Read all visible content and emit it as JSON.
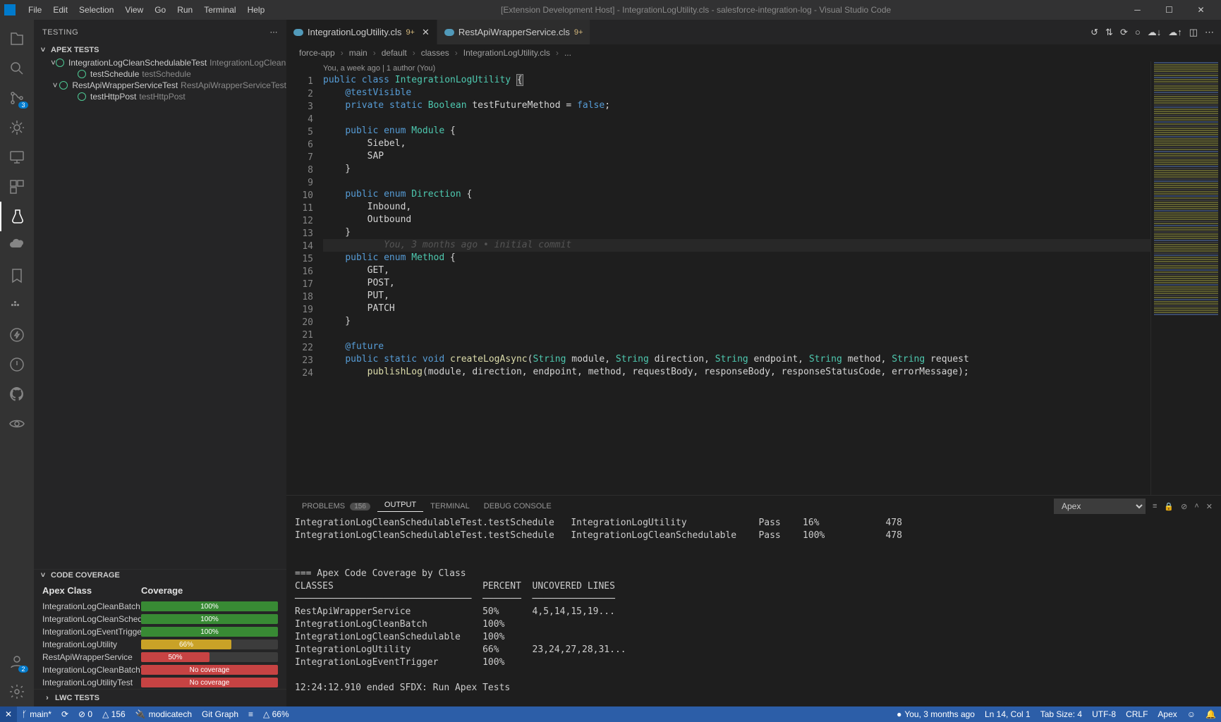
{
  "titlebar": {
    "title": "[Extension Development Host] - IntegrationLogUtility.cls - salesforce-integration-log - Visual Studio Code"
  },
  "menu": [
    "File",
    "Edit",
    "Selection",
    "View",
    "Go",
    "Run",
    "Terminal",
    "Help"
  ],
  "activity_badges": {
    "scm": "3",
    "accounts": "2"
  },
  "sidebar": {
    "title": "TESTING",
    "apex_tests_label": "APEX TESTS",
    "tests": [
      {
        "name": "IntegrationLogCleanSchedulableTest",
        "sub": "IntegrationLogCleanSchedula...",
        "indent": 24,
        "chev": "˅",
        "children": [
          {
            "name": "testSchedule",
            "sub": "testSchedule",
            "indent": 48
          }
        ]
      },
      {
        "name": "RestApiWrapperServiceTest",
        "sub": "RestApiWrapperServiceTest",
        "indent": 24,
        "chev": "˅",
        "children": [
          {
            "name": "testHttpPost",
            "sub": "testHttpPost",
            "indent": 48
          }
        ]
      }
    ],
    "coverage_label": "CODE COVERAGE",
    "coverage_col_class": "Apex Class",
    "coverage_col_cov": "Coverage",
    "coverage": [
      {
        "name": "IntegrationLogCleanBatch",
        "pct": 100,
        "label": "100%",
        "color": "#388a34"
      },
      {
        "name": "IntegrationLogCleanSchedulable",
        "pct": 100,
        "label": "100%",
        "color": "#388a34"
      },
      {
        "name": "IntegrationLogEventTrigger",
        "pct": 100,
        "label": "100%",
        "color": "#388a34"
      },
      {
        "name": "IntegrationLogUtility",
        "pct": 66,
        "label": "66%",
        "color": "#c9a227"
      },
      {
        "name": "RestApiWrapperService",
        "pct": 50,
        "label": "50%",
        "color": "#c74343"
      },
      {
        "name": "IntegrationLogCleanBatchTest",
        "pct": 100,
        "label": "No coverage",
        "color": "#c74343"
      },
      {
        "name": "IntegrationLogUtilityTest",
        "pct": 100,
        "label": "No coverage",
        "color": "#c74343"
      }
    ],
    "lwc_label": "LWC TESTS"
  },
  "tabs": [
    {
      "label": "IntegrationLogUtility.cls",
      "modified": "9+",
      "active": true,
      "closeable": true
    },
    {
      "label": "RestApiWrapperService.cls",
      "modified": "9+",
      "active": false,
      "closeable": false
    }
  ],
  "breadcrumbs": [
    "force-app",
    "main",
    "default",
    "classes",
    "IntegrationLogUtility.cls",
    "..."
  ],
  "codelens": "You, a week ago | 1 author (You)",
  "code": {
    "lines": [
      {
        "n": 1,
        "html": "<span class='kw'>public</span> <span class='kw'>class</span> <span class='type'>IntegrationLogUtility</span> <span class='bracket-match'>{</span>"
      },
      {
        "n": 2,
        "html": "    <span class='annotation'>@testVisible</span>"
      },
      {
        "n": 3,
        "html": "    <span class='kw'>private</span> <span class='kw'>static</span> <span class='type'>Boolean</span> testFutureMethod = <span class='bool'>false</span>;"
      },
      {
        "n": 4,
        "html": ""
      },
      {
        "n": 5,
        "html": "    <span class='kw'>public</span> <span class='kw'>enum</span> <span class='enumname'>Module</span> {"
      },
      {
        "n": 6,
        "html": "        Siebel,"
      },
      {
        "n": 7,
        "html": "        SAP"
      },
      {
        "n": 8,
        "html": "    }"
      },
      {
        "n": 9,
        "html": ""
      },
      {
        "n": 10,
        "html": "    <span class='kw'>public</span> <span class='kw'>enum</span> <span class='enumname'>Direction</span> {"
      },
      {
        "n": 11,
        "html": "        Inbound,"
      },
      {
        "n": 12,
        "html": "        Outbound"
      },
      {
        "n": 13,
        "html": "    }"
      },
      {
        "n": 14,
        "html": "           <span class='gitlens'>You, 3 months ago • initial commit</span>",
        "hl": true
      },
      {
        "n": 15,
        "html": "    <span class='kw'>public</span> <span class='kw'>enum</span> <span class='enumname'>Method</span> {"
      },
      {
        "n": 16,
        "html": "        GET,"
      },
      {
        "n": 17,
        "html": "        POST,"
      },
      {
        "n": 18,
        "html": "        PUT,"
      },
      {
        "n": 19,
        "html": "        PATCH"
      },
      {
        "n": 20,
        "html": "    }"
      },
      {
        "n": 21,
        "html": ""
      },
      {
        "n": 22,
        "html": "    <span class='annotation'>@future</span>"
      },
      {
        "n": 23,
        "html": "    <span class='kw'>public</span> <span class='kw'>static</span> <span class='kw'>void</span> <span class='fn'>createLogAsync</span>(<span class='type'>String</span> module, <span class='type'>String</span> direction, <span class='type'>String</span> endpoint, <span class='type'>String</span> method, <span class='type'>String</span> request"
      },
      {
        "n": 24,
        "html": "        <span class='fn'>publishLog</span>(module, direction, endpoint, method, requestBody, responseBody, responseStatusCode, errorMessage);"
      }
    ]
  },
  "panel": {
    "problems_label": "PROBLEMS",
    "problems_badge": "156",
    "output_label": "OUTPUT",
    "terminal_label": "TERMINAL",
    "debug_label": "DEBUG CONSOLE",
    "channel": "Apex",
    "output_lines": [
      "IntegrationLogCleanSchedulableTest.testSchedule   IntegrationLogUtility             Pass    16%            478",
      "IntegrationLogCleanSchedulableTest.testSchedule   IntegrationLogCleanSchedulable    Pass    100%           478",
      "",
      "",
      "=== Apex Code Coverage by Class",
      "CLASSES                           PERCENT  UNCOVERED LINES",
      "────────────────────────────────  ───────  ───────────────",
      "RestApiWrapperService             50%      4,5,14,15,19...",
      "IntegrationLogCleanBatch          100%",
      "IntegrationLogCleanSchedulable    100%",
      "IntegrationLogUtility             66%      23,24,27,28,31...",
      "IntegrationLogEventTrigger        100%",
      "",
      "12:24:12.910 ended SFDX: Run Apex Tests"
    ]
  },
  "status": {
    "remote": "✕",
    "branch": "main*",
    "sync": "⟳",
    "errors": "⊘ 0",
    "warnings": "△ 156",
    "org": "modicatech",
    "gitgraph": "Git Graph",
    "coverage": "△ 66%",
    "blame": "You, 3 months ago",
    "position": "Ln 14, Col 1",
    "tabsize": "Tab Size: 4",
    "encoding": "UTF-8",
    "eol": "CRLF",
    "lang": "Apex",
    "feedback": "☺",
    "bell": "🔔"
  }
}
